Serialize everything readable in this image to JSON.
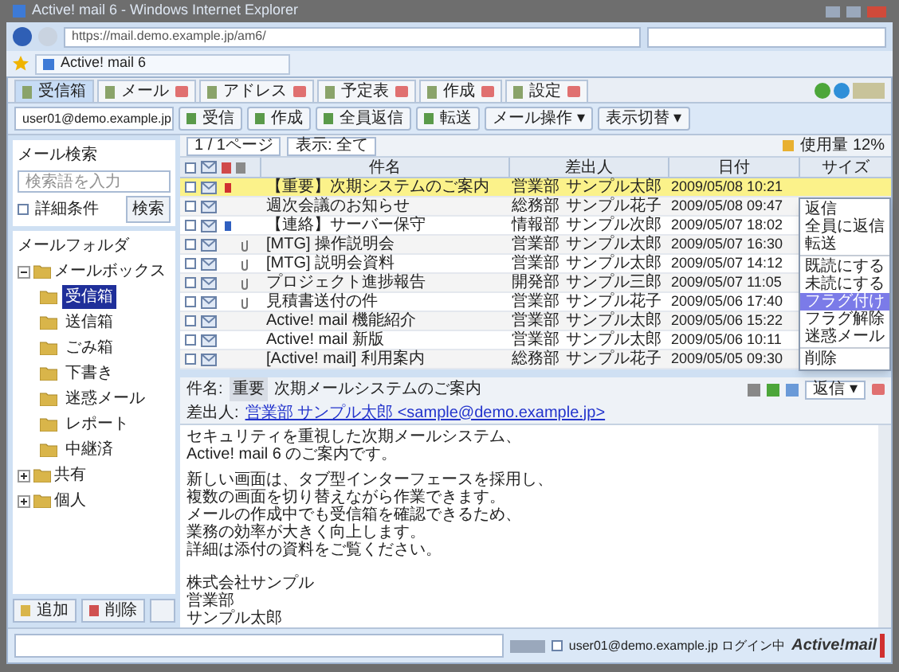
{
  "window": {
    "title": "Active! mail 6 - Windows Internet Explorer"
  },
  "browser": {
    "address": "https://mail.demo.example.jp/am6/",
    "tab": "Active! mail 6"
  },
  "app_tabs": [
    {
      "label": "受信箱",
      "selected": true,
      "closable": false
    },
    {
      "label": "メール",
      "selected": false,
      "closable": true
    },
    {
      "label": "アドレス",
      "selected": false,
      "closable": true
    },
    {
      "label": "予定表",
      "selected": false,
      "closable": true
    },
    {
      "label": "作成",
      "selected": false,
      "closable": true
    },
    {
      "label": "設定",
      "selected": false,
      "closable": true
    }
  ],
  "toolbar": {
    "account": "user01@demo.example.jp",
    "buttons": [
      {
        "label": "受信"
      },
      {
        "label": "作成"
      },
      {
        "label": "全員返信"
      },
      {
        "label": "転送"
      },
      {
        "label": "メール操作 ▾"
      },
      {
        "label": "表示切替 ▾"
      }
    ]
  },
  "search": {
    "title": "メール検索",
    "placeholder": "検索語を入力",
    "option": "詳細条件",
    "option_checked": false,
    "button": "検索"
  },
  "folders": {
    "title": "メールフォルダ",
    "root": {
      "label": "メールボックス",
      "expanded": true,
      "children": [
        {
          "label": "受信箱",
          "selected": true
        },
        {
          "label": "送信箱",
          "selected": false
        },
        {
          "label": "ごみ箱",
          "selected": false
        },
        {
          "label": "下書き",
          "selected": false
        },
        {
          "label": "迷惑メール",
          "selected": false
        },
        {
          "label": "レポート",
          "selected": false
        },
        {
          "label": "中継済",
          "selected": false
        }
      ]
    },
    "others": [
      {
        "label": "共有",
        "expanded": false
      },
      {
        "label": "個人",
        "expanded": false
      }
    ]
  },
  "left_buttons": [
    {
      "label": "追加"
    },
    {
      "label": "削除"
    }
  ],
  "list": {
    "page": "1 / 1ページ",
    "filter": "表示: 全て",
    "quota": "使用量 12%",
    "all_checked": false,
    "columns": [
      "件名",
      "差出人",
      "日付",
      "サイズ"
    ],
    "rows": [
      {
        "subject": "【重要】次期システムのご案内",
        "from": "営業部",
        "name": "サンプル太郎",
        "date": "2009/05/08 10:21",
        "high_priority": true,
        "low_priority": false,
        "attachment": false,
        "checked": false,
        "selected": true
      },
      {
        "subject": "週次会議のお知らせ",
        "from": "総務部",
        "name": "サンプル花子",
        "date": "2009/05/08 09:47",
        "high_priority": false,
        "low_priority": false,
        "attachment": false,
        "checked": false,
        "selected": false
      },
      {
        "subject": "【連絡】サーバー保守",
        "from": "情報部",
        "name": "サンプル次郎",
        "date": "2009/05/07 18:02",
        "high_priority": false,
        "low_priority": true,
        "attachment": false,
        "checked": false,
        "selected": false
      },
      {
        "subject": "[MTG] 操作説明会",
        "from": "営業部",
        "name": "サンプル太郎",
        "date": "2009/05/07 16:30",
        "high_priority": false,
        "low_priority": false,
        "attachment": true,
        "checked": false,
        "selected": false
      },
      {
        "subject": "[MTG] 説明会資料",
        "from": "営業部",
        "name": "サンプル太郎",
        "date": "2009/05/07 14:12",
        "high_priority": false,
        "low_priority": false,
        "attachment": true,
        "checked": false,
        "selected": false
      },
      {
        "subject": "プロジェクト進捗報告",
        "from": "開発部",
        "name": "サンプル三郎",
        "date": "2009/05/07 11:05",
        "high_priority": false,
        "low_priority": false,
        "attachment": true,
        "checked": false,
        "selected": false
      },
      {
        "subject": "見積書送付の件",
        "from": "営業部",
        "name": "サンプル花子",
        "date": "2009/05/06 17:40",
        "high_priority": false,
        "low_priority": false,
        "attachment": true,
        "checked": false,
        "selected": false
      },
      {
        "subject": "Active! mail 機能紹介",
        "from": "営業部",
        "name": "サンプル太郎",
        "date": "2009/05/06 15:22",
        "high_priority": false,
        "low_priority": false,
        "attachment": false,
        "checked": false,
        "selected": false
      },
      {
        "subject": "Active! mail 新版",
        "from": "営業部",
        "name": "サンプル太郎",
        "date": "2009/05/06 10:11",
        "high_priority": false,
        "low_priority": false,
        "attachment": false,
        "checked": false,
        "selected": false
      },
      {
        "subject": "[Active! mail] 利用案内",
        "from": "総務部",
        "name": "サンプル花子",
        "date": "2009/05/05 09:30",
        "high_priority": false,
        "low_priority": false,
        "attachment": false,
        "checked": false,
        "selected": false
      }
    ]
  },
  "context_menu": {
    "groups": [
      [
        {
          "label": "返信",
          "selected": false
        },
        {
          "label": "全員に返信",
          "selected": false
        },
        {
          "label": "転送",
          "selected": false
        }
      ],
      [
        {
          "label": "既読にする",
          "selected": false
        },
        {
          "label": "未読にする",
          "selected": false
        },
        {
          "label": "フラグ付け",
          "selected": true
        },
        {
          "label": "フラグ解除",
          "selected": false
        },
        {
          "label": "迷惑メール",
          "selected": false
        }
      ],
      [
        {
          "label": "削除",
          "selected": false
        }
      ]
    ]
  },
  "preview": {
    "subject_label": "件名:",
    "tag": "重要",
    "subject": "次期メールシステムのご案内",
    "from_label": "差出人:",
    "from": "営業部 サンプル太郎 <sample@demo.example.jp>",
    "reply": "返信 ▾",
    "paragraphs": [
      [
        "セキュリティを重視した次期メールシステム、",
        "Active! mail 6 のご案内です。"
      ],
      [
        "新しい画面は、タブ型インターフェースを採用し、",
        "複数の画面を切り替えながら作業できます。",
        "メールの作成中でも受信箱を確認できるため、",
        "業務の効率が大きく向上します。",
        "詳細は添付の資料をご覧ください。"
      ]
    ],
    "signature": [
      "株式会社サンプル",
      "営業部",
      "サンプル太郎"
    ]
  },
  "status": {
    "session": "user01@demo.example.jp ログイン中",
    "session_checked": false,
    "logo": "Active!mail"
  }
}
